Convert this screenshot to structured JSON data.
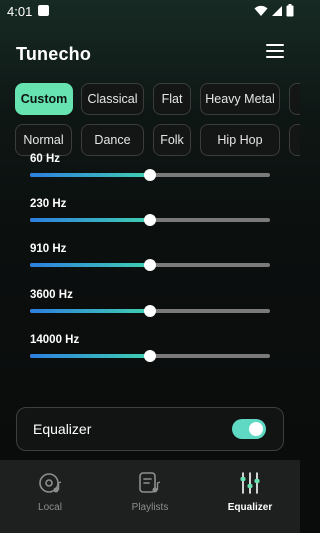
{
  "status_bar": {
    "time": "4:01"
  },
  "header": {
    "title": "Tunecho"
  },
  "presets": [
    {
      "label": "Custom",
      "active": true
    },
    {
      "label": "Classical",
      "active": false
    },
    {
      "label": "Flat",
      "active": false
    },
    {
      "label": "Heavy Metal",
      "active": false
    },
    {
      "label": "Normal",
      "active": false
    },
    {
      "label": "Dance",
      "active": false
    },
    {
      "label": "Folk",
      "active": false
    },
    {
      "label": "Hip Hop",
      "active": false
    }
  ],
  "bands": [
    {
      "label": "60 Hz",
      "level": 0.5
    },
    {
      "label": "230 Hz",
      "level": 0.5
    },
    {
      "label": "910 Hz",
      "level": 0.5
    },
    {
      "label": "3600 Hz",
      "level": 0.5
    },
    {
      "label": "14000 Hz",
      "level": 0.5
    }
  ],
  "equalizer_toggle": {
    "label": "Equalizer",
    "enabled": true
  },
  "bottom_nav": [
    {
      "label": "Local",
      "icon": "vinyl-note-icon",
      "active": false
    },
    {
      "label": "Playlists",
      "icon": "playlist-note-icon",
      "active": false
    },
    {
      "label": "Equalizer",
      "icon": "equalizer-sliders-icon",
      "active": true
    }
  ],
  "colors": {
    "accent": "#67e3b1",
    "slider_gradient_start": "#2d7fe0",
    "slider_gradient_end": "#3fd0b0",
    "toggle_on": "#5fd9c4"
  }
}
